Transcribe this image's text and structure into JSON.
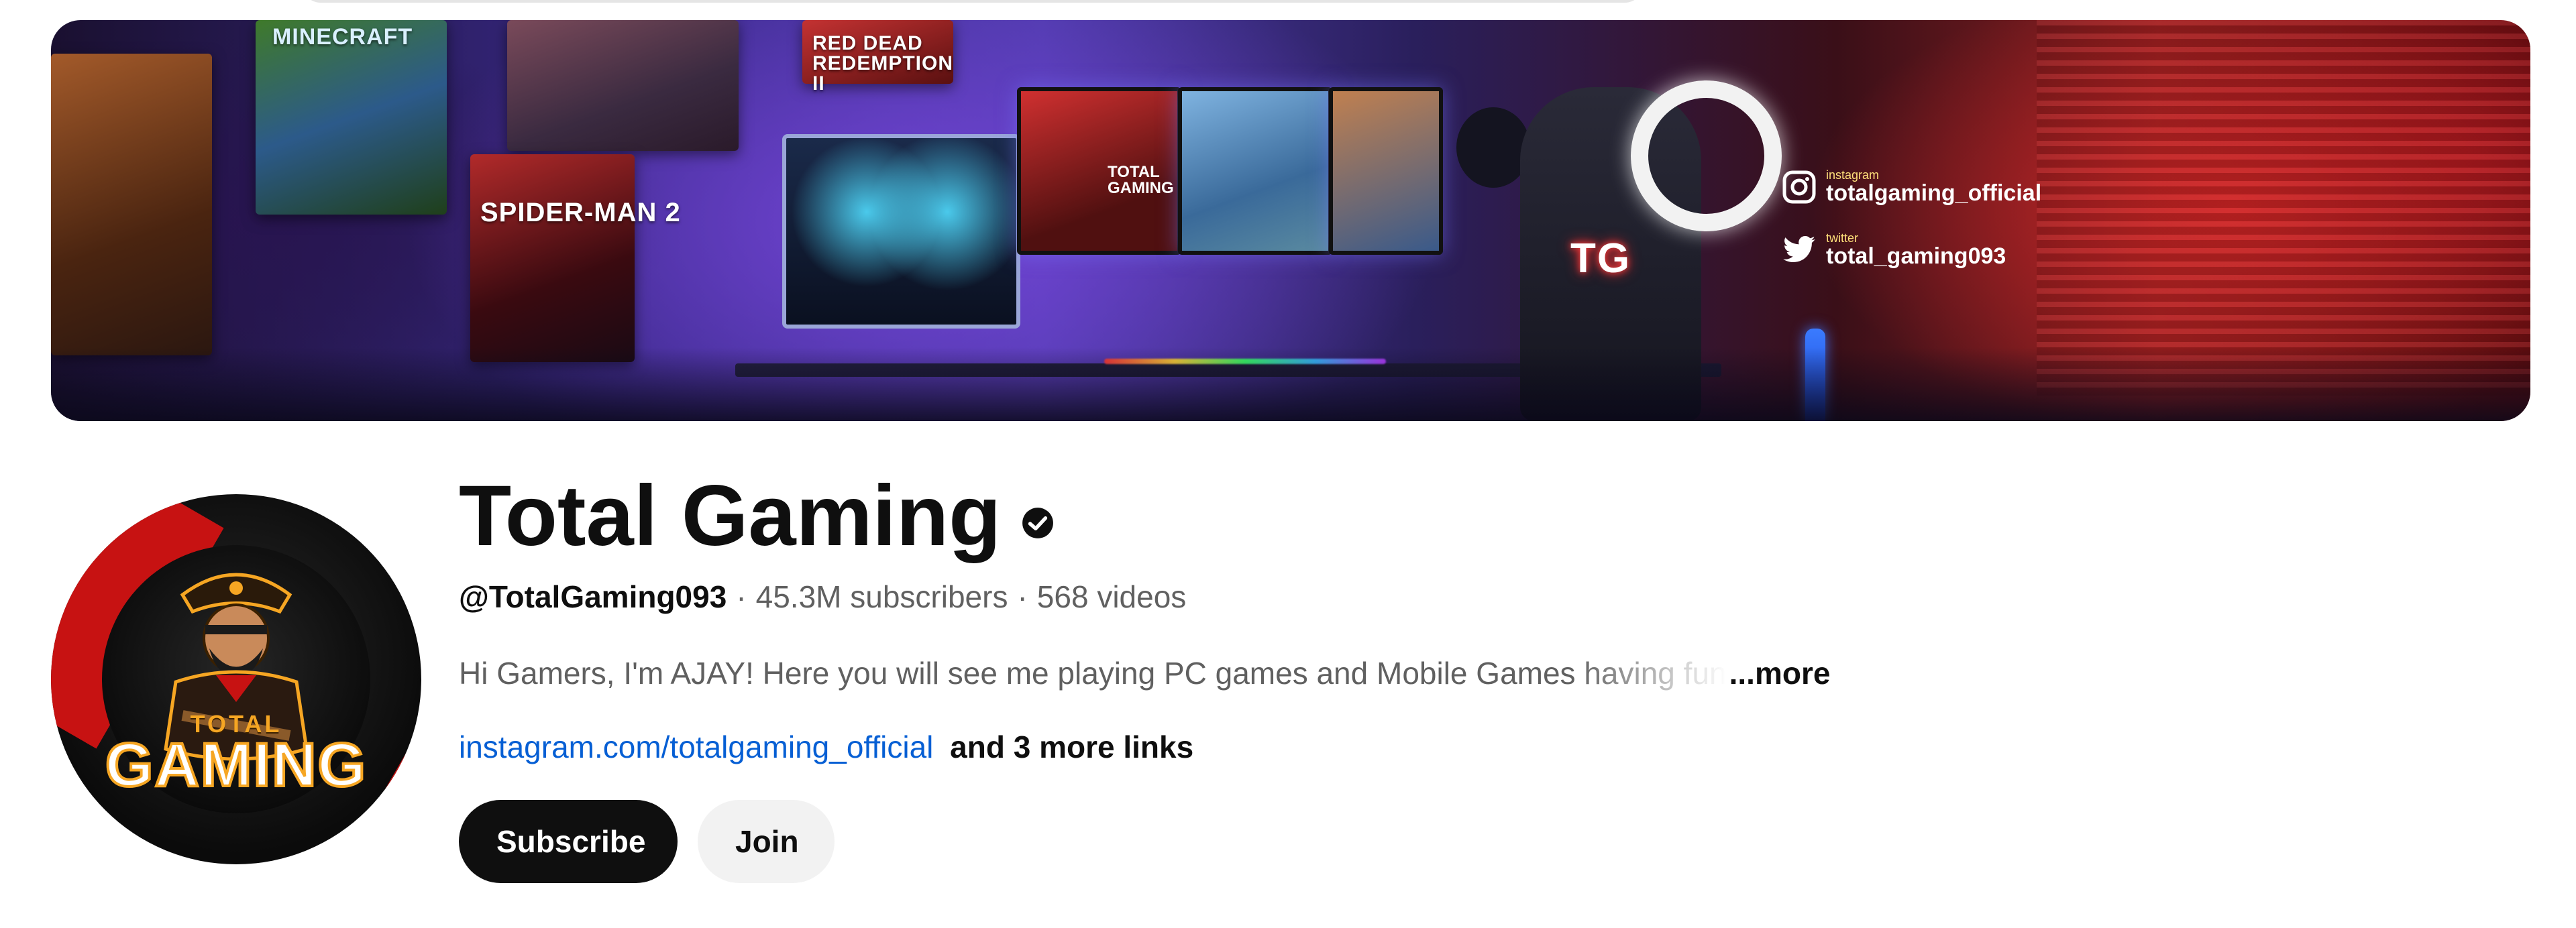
{
  "banner": {
    "posters": {
      "minecraft": "MINECRAFT",
      "red_dead": "RED DEAD REDEMPTION II",
      "spider_man": "SPIDER-MAN 2"
    },
    "monitor_label": "TOTAL GAMING",
    "chair_logo": "TG",
    "social": {
      "instagram_label": "instagram",
      "instagram_handle": "totalgaming_official",
      "twitter_label": "twitter",
      "twitter_handle": "total_gaming093"
    }
  },
  "avatar": {
    "line1": "TOTAL",
    "line2": "GAMING"
  },
  "channel": {
    "name": "Total Gaming",
    "handle": "@TotalGaming093",
    "subscribers": "45.3M subscribers",
    "videos": "568 videos",
    "separator": "·",
    "description": "Hi Gamers,  I'm AJAY! Here you will see me playing PC games and Mobile Games having fun",
    "more_label": "...more",
    "link": "instagram.com/totalgaming_official",
    "more_links": "and 3 more links"
  },
  "actions": {
    "subscribe_label": "Subscribe",
    "join_label": "Join"
  },
  "colors": {
    "link": "#065fd4",
    "primary_button": "#0f0f0f",
    "secondary_button": "#f2f2f2",
    "muted_text": "#606060"
  }
}
